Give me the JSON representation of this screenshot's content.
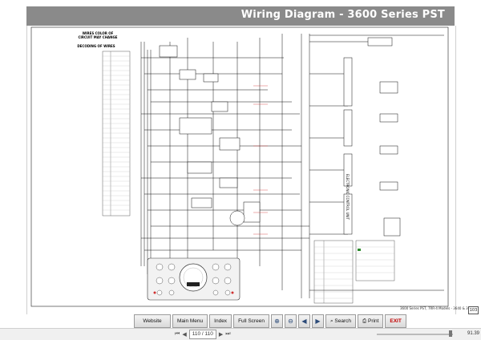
{
  "header": {
    "title": "Wiring Diagram - 3600 Series PST"
  },
  "diagram": {
    "legend_title_1": "WIRES COLOR OF",
    "legend_title_2": "CIRCUIT MAY CHANGE",
    "legend_title_3": "DECODING OF WIRES",
    "vertical_label": "ELECTRONIC CONTROL UNIT",
    "footer_caption": "3600 Series PST, 7RR-4 Models - 3640 & 3650",
    "page_number": "103",
    "colors": {
      "wire": "#111111",
      "red_label": "#d03030",
      "gauge_panel": "#f2f2f2"
    }
  },
  "toolbar": {
    "website": "Website",
    "main_menu": "Main Menu",
    "index": "Index",
    "full_screen": "Full Screen",
    "search": "Search",
    "print": "Print",
    "exit": "EXIT",
    "icons": [
      "zoom-in-icon",
      "zoom-out-icon",
      "back-icon",
      "forward-icon",
      "search-icon",
      "print-icon"
    ]
  },
  "status": {
    "page_indicator": "110 / 110",
    "zoom": "91.39"
  }
}
